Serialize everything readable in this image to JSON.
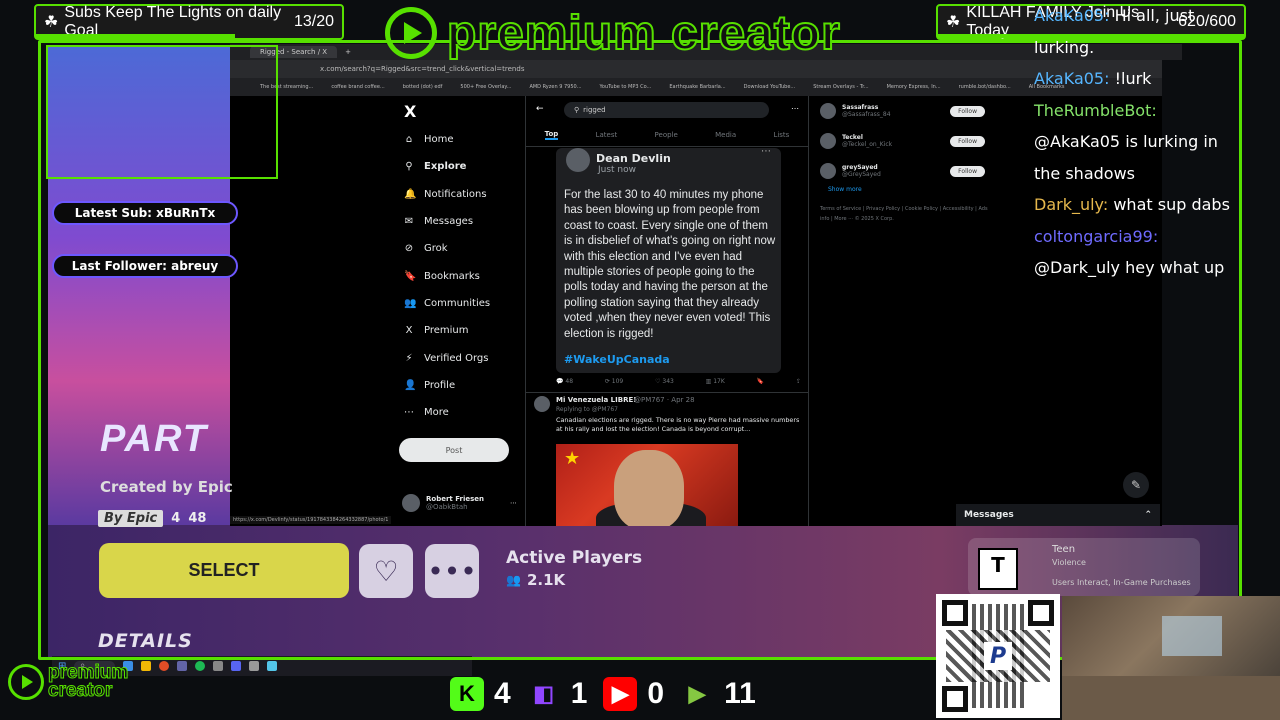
{
  "goals": {
    "left": {
      "label": "Subs Keep The Lights on daily Goal",
      "value": "13/20",
      "progress": 0.65
    },
    "right": {
      "label": "KILLAH FAMILY Join Us Today",
      "value": "620/600",
      "progress": 1.0
    }
  },
  "brand": {
    "name": "premium creator",
    "small_line1": "premium",
    "small_line2": "creator",
    "accent_color": "#57e000"
  },
  "overlay": {
    "latest_sub": "Latest Sub: xBuRnTx",
    "last_follower": "Last Follower: abreuy"
  },
  "browser": {
    "tab_title": "Rigged - Search / X",
    "url": "x.com/search?q=Rigged&src=trend_click&vertical=trends",
    "bookmarks": [
      "The best streaming...",
      "coffee brand coffee...",
      "botted (dot) edf",
      "500+ Free Overlay...",
      "AMD Ryzen 9 7950...",
      "YouTube to MP3 Co...",
      "Earthquake Barbarla...",
      "Download YouTube...",
      "Stream Overlays - Tr...",
      "Memory Express, In...",
      "rumble.bot/dashbo...",
      "All Bookmarks"
    ],
    "status_url": "https://x.com/Devlinfy/status/1917843384264332887/photo/1"
  },
  "x_nav": {
    "logo": "X",
    "items": [
      {
        "label": "Home",
        "icon": "home-icon",
        "glyph": "⌂"
      },
      {
        "label": "Explore",
        "icon": "search-icon",
        "glyph": "⚲"
      },
      {
        "label": "Notifications",
        "icon": "bell-icon",
        "glyph": "🔔"
      },
      {
        "label": "Messages",
        "icon": "envelope-icon",
        "glyph": "✉"
      },
      {
        "label": "Grok",
        "icon": "grok-icon",
        "glyph": "⊘"
      },
      {
        "label": "Bookmarks",
        "icon": "bookmark-icon",
        "glyph": "🔖"
      },
      {
        "label": "Communities",
        "icon": "people-icon",
        "glyph": "👥"
      },
      {
        "label": "Premium",
        "icon": "x-premium-icon",
        "glyph": "X"
      },
      {
        "label": "Verified Orgs",
        "icon": "lightning-icon",
        "glyph": "⚡"
      },
      {
        "label": "Profile",
        "icon": "person-icon",
        "glyph": "👤"
      },
      {
        "label": "More",
        "icon": "more-circle-icon",
        "glyph": "⋯"
      }
    ],
    "post_label": "Post",
    "profile_name": "Robert Friesen",
    "profile_handle": "@OabkBtah"
  },
  "search": {
    "query": "rigged",
    "tabs": [
      "Top",
      "Latest",
      "People",
      "Media",
      "Lists"
    ],
    "active_tab": "Top"
  },
  "tweet1": {
    "author": "Dean Devlin",
    "time": "Just now",
    "text": "For the last 30 to 40 minutes my phone has been blowing up from people from coast to coast. Every single one of them is in disbelief of what's going on right now with this election and I've even had multiple stories of people going to the polls today and having the person at the polling station saying that they already voted ,when they never even voted! This election is rigged!",
    "hashtag": "#WakeUpCanada",
    "replies": "48",
    "reposts": "109",
    "likes": "343",
    "views": "17K"
  },
  "tweet2": {
    "author": "Mi Venezuela LIBRE!",
    "handle": "@PM767 · Apr 28",
    "reply_to": "Replying to @PM767",
    "text": "Canadian elections are rigged. There is no way Pierre had massive numbers at his rally and lost the election! Canada is beyond corrupt..."
  },
  "who_to_follow": {
    "items": [
      {
        "name": "Sassafrass",
        "handle": "@Sassafrass_84",
        "button": "Follow"
      },
      {
        "name": "Teckel",
        "handle": "@Teckel_on_Kick",
        "button": "Follow"
      },
      {
        "name": "greySayed",
        "handle": "@GreySayed",
        "button": "Follow"
      }
    ],
    "show_more": "Show more",
    "footer": "Terms of Service | Privacy Policy | Cookie Policy | Accessibility | Ads info | More ··· © 2025 X Corp."
  },
  "messages_label": "Messages",
  "chat": [
    {
      "user": "AkaKa05:",
      "text": "Hi all, just",
      "color": "#56b6ff"
    },
    {
      "user": "",
      "text": "lurking.",
      "color": "#ffffff"
    },
    {
      "user": "AkaKa05:",
      "text": "!lurk",
      "color": "#56b6ff"
    },
    {
      "user": "TheRumbleBot:",
      "text": "",
      "color": "#85e26a"
    },
    {
      "user": "",
      "text": "@AkaKa05 is lurking in",
      "color": "#ffffff"
    },
    {
      "user": "",
      "text": "the shadows",
      "color": "#ffffff"
    },
    {
      "user": "Dark_uly:",
      "text": "what sup dabs",
      "color": "#e6b84d"
    },
    {
      "user": "coltongarcia99:",
      "text": "",
      "color": "#6f6bff"
    },
    {
      "user": "",
      "text": "@Dark_uly hey what up",
      "color": "#ffffff"
    }
  ],
  "game": {
    "title": "PART",
    "created_by": "Created by Epic",
    "badge": "By Epic",
    "badge_num1": "4",
    "badge_num2": "48",
    "select_label": "SELECT",
    "active_players_label": "Active Players",
    "active_players_count": "2.1K",
    "details_label": "DETAILS",
    "esrb_rating": "Teen",
    "esrb_desc": "Violence",
    "esrb_extra": "Users Interact, In-Game Purchases",
    "esrb_logo": "T"
  },
  "platform_counts": [
    {
      "platform": "kick",
      "icon": "kick-icon",
      "glyph": "K",
      "count": "4",
      "color": "#53fc18"
    },
    {
      "platform": "twitch",
      "icon": "twitch-icon",
      "glyph": "◧",
      "count": "1",
      "color": "#9146ff"
    },
    {
      "platform": "youtube",
      "icon": "youtube-icon",
      "glyph": "▶",
      "count": "0",
      "color": "#ff0000"
    },
    {
      "platform": "rumble",
      "icon": "rumble-icon",
      "glyph": "▶",
      "count": "11",
      "color": "#85c742"
    }
  ]
}
